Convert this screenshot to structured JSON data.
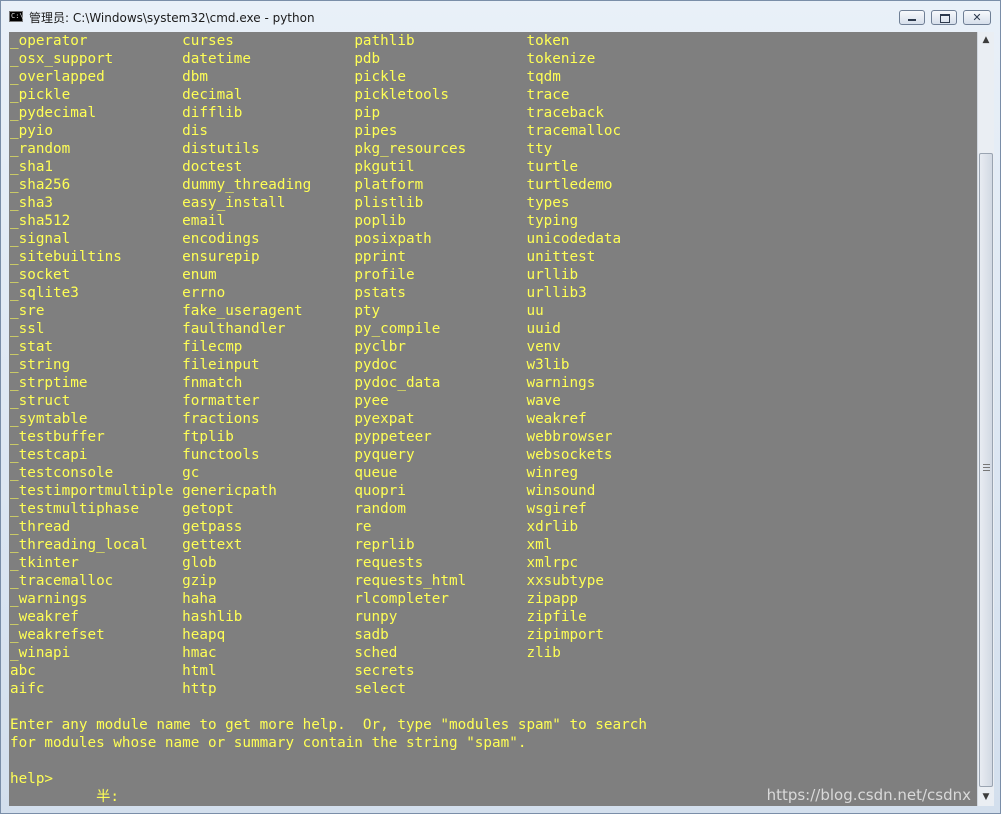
{
  "window": {
    "title": "管理员: C:\\Windows\\system32\\cmd.exe - python",
    "icon": "cmd-icon",
    "controls": {
      "minimize": "minimize-icon",
      "maximize": "maximize-icon",
      "close": "close-icon"
    }
  },
  "console": {
    "columns": [
      [
        "_operator",
        "_osx_support",
        "_overlapped",
        "_pickle",
        "_pydecimal",
        "_pyio",
        "_random",
        "_sha1",
        "_sha256",
        "_sha3",
        "_sha512",
        "_signal",
        "_sitebuiltins",
        "_socket",
        "_sqlite3",
        "_sre",
        "_ssl",
        "_stat",
        "_string",
        "_strptime",
        "_struct",
        "_symtable",
        "_testbuffer",
        "_testcapi",
        "_testconsole",
        "_testimportmultiple",
        "_testmultiphase",
        "_thread",
        "_threading_local",
        "_tkinter",
        "_tracemalloc",
        "_warnings",
        "_weakref",
        "_weakrefset",
        "_winapi",
        "abc",
        "aifc"
      ],
      [
        "curses",
        "datetime",
        "dbm",
        "decimal",
        "difflib",
        "dis",
        "distutils",
        "doctest",
        "dummy_threading",
        "easy_install",
        "email",
        "encodings",
        "ensurepip",
        "enum",
        "errno",
        "fake_useragent",
        "faulthandler",
        "filecmp",
        "fileinput",
        "fnmatch",
        "formatter",
        "fractions",
        "ftplib",
        "functools",
        "gc",
        "genericpath",
        "getopt",
        "getpass",
        "gettext",
        "glob",
        "gzip",
        "haha",
        "hashlib",
        "heapq",
        "hmac",
        "html",
        "http"
      ],
      [
        "pathlib",
        "pdb",
        "pickle",
        "pickletools",
        "pip",
        "pipes",
        "pkg_resources",
        "pkgutil",
        "platform",
        "plistlib",
        "poplib",
        "posixpath",
        "pprint",
        "profile",
        "pstats",
        "pty",
        "py_compile",
        "pyclbr",
        "pydoc",
        "pydoc_data",
        "pyee",
        "pyexpat",
        "pyppeteer",
        "pyquery",
        "queue",
        "quopri",
        "random",
        "re",
        "reprlib",
        "requests",
        "requests_html",
        "rlcompleter",
        "runpy",
        "sadb",
        "sched",
        "secrets",
        "select"
      ],
      [
        "token",
        "tokenize",
        "tqdm",
        "trace",
        "traceback",
        "tracemalloc",
        "tty",
        "turtle",
        "turtledemo",
        "types",
        "typing",
        "unicodedata",
        "unittest",
        "urllib",
        "urllib3",
        "uu",
        "uuid",
        "venv",
        "w3lib",
        "warnings",
        "wave",
        "weakref",
        "webbrowser",
        "websockets",
        "winreg",
        "winsound",
        "wsgiref",
        "xdrlib",
        "xml",
        "xmlrpc",
        "xxsubtype",
        "zipapp",
        "zipfile",
        "zipimport",
        "zlib"
      ]
    ],
    "help_lines": [
      "Enter any module name to get more help.  Or, type \"modules spam\" to search",
      "for modules whose name or summary contain the string \"spam\"."
    ],
    "prompt": "help>",
    "ime_status": "半:",
    "text_color": "#ffff55",
    "background_color": "#7f7f7f"
  },
  "watermark": "https://blog.csdn.net/csdnx",
  "scrollbar": {
    "up_icon": "scroll-up-arrow-icon",
    "down_icon": "scroll-down-arrow-icon"
  }
}
